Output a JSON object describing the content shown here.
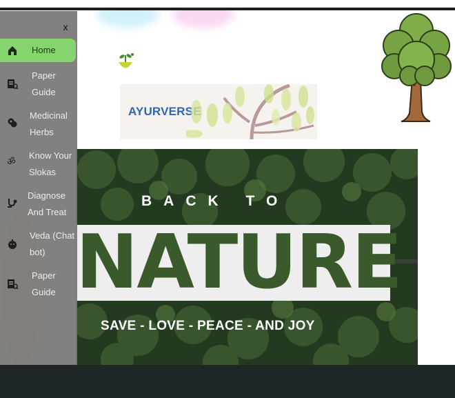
{
  "sidebar": {
    "close_label": "x",
    "items": [
      {
        "label": "Home",
        "icon": "home-icon",
        "active": true
      },
      {
        "label": "Paper Guide",
        "icon": "document-search-icon"
      },
      {
        "label": "Medicinal Herbs",
        "icon": "herb-icon"
      },
      {
        "label": "Know Your Slokas",
        "icon": "om-icon"
      },
      {
        "label": "Diagnose And Treat",
        "icon": "stethoscope-icon"
      },
      {
        "label": "Veda (Chat bot)",
        "icon": "chatbot-icon"
      },
      {
        "label": "Paper Guide",
        "icon": "document-search-icon"
      }
    ]
  },
  "brand": {
    "name": "AYURVERSE"
  },
  "hero": {
    "line1": "BACK TO",
    "line2": "NATURE",
    "line3": "SAVE - LOVE - PEACE - AND JOY"
  },
  "colors": {
    "sidebar_active": "#86d46d",
    "brand_blue": "#2f66b3",
    "footer": "#1f2628"
  }
}
